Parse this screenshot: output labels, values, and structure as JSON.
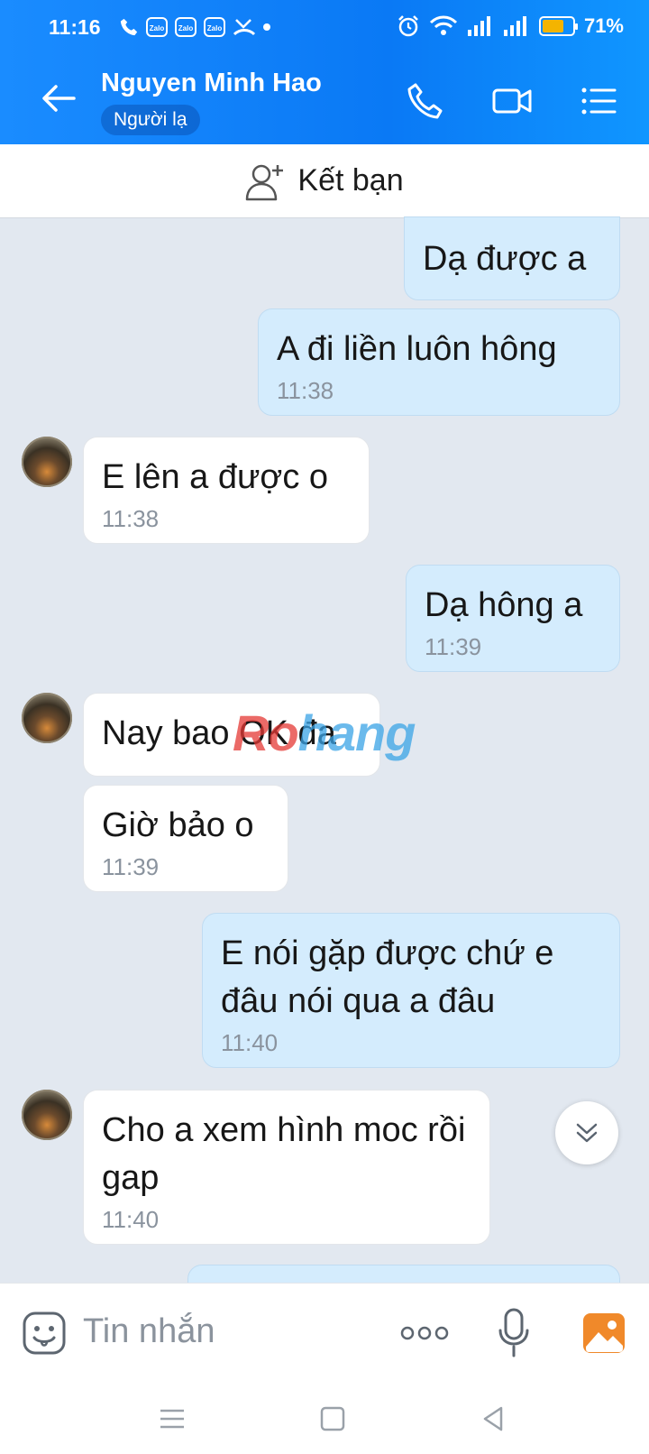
{
  "status_bar": {
    "time": "11:16",
    "zalo_label": "Zalo",
    "battery_percent": "71%",
    "battery_level": 0.71
  },
  "header": {
    "contact_name": "Nguyen Minh Hao",
    "badge": "Người lạ",
    "icons": [
      "back-arrow-icon",
      "phone-icon",
      "video-call-icon",
      "menu-list-icon"
    ]
  },
  "friend_bar": {
    "label": "Kết bạn",
    "icon": "add-friend-icon"
  },
  "messages": [
    {
      "side": "out",
      "text": "Dạ được a",
      "time": ""
    },
    {
      "side": "out",
      "text": "A đi liền luôn hông",
      "time": "11:38"
    },
    {
      "side": "in",
      "text": "E lên a được o",
      "time": "11:38"
    },
    {
      "side": "out",
      "text": "Dạ hông a",
      "time": "11:39"
    },
    {
      "side": "in",
      "text": "Nay bao OK đa",
      "time": ""
    },
    {
      "side": "in",
      "text": "Giờ bảo o",
      "time": "11:39"
    },
    {
      "side": "out",
      "text": "E nói gặp được chứ e đâu nói qua a đâu",
      "time": "11:40"
    },
    {
      "side": "in",
      "text": "Cho a xem hình moc rồi gap",
      "time": "11:40"
    }
  ],
  "watermark": {
    "part1": "Ro",
    "part2": "hang"
  },
  "input": {
    "placeholder": "Tin nhắn"
  },
  "colors": {
    "header_blue": "#0a79f5",
    "outgoing_bubble": "#d4ecfd",
    "incoming_bubble": "#ffffff",
    "chat_background": "#e2e8f0",
    "battery": "#f4b400"
  }
}
